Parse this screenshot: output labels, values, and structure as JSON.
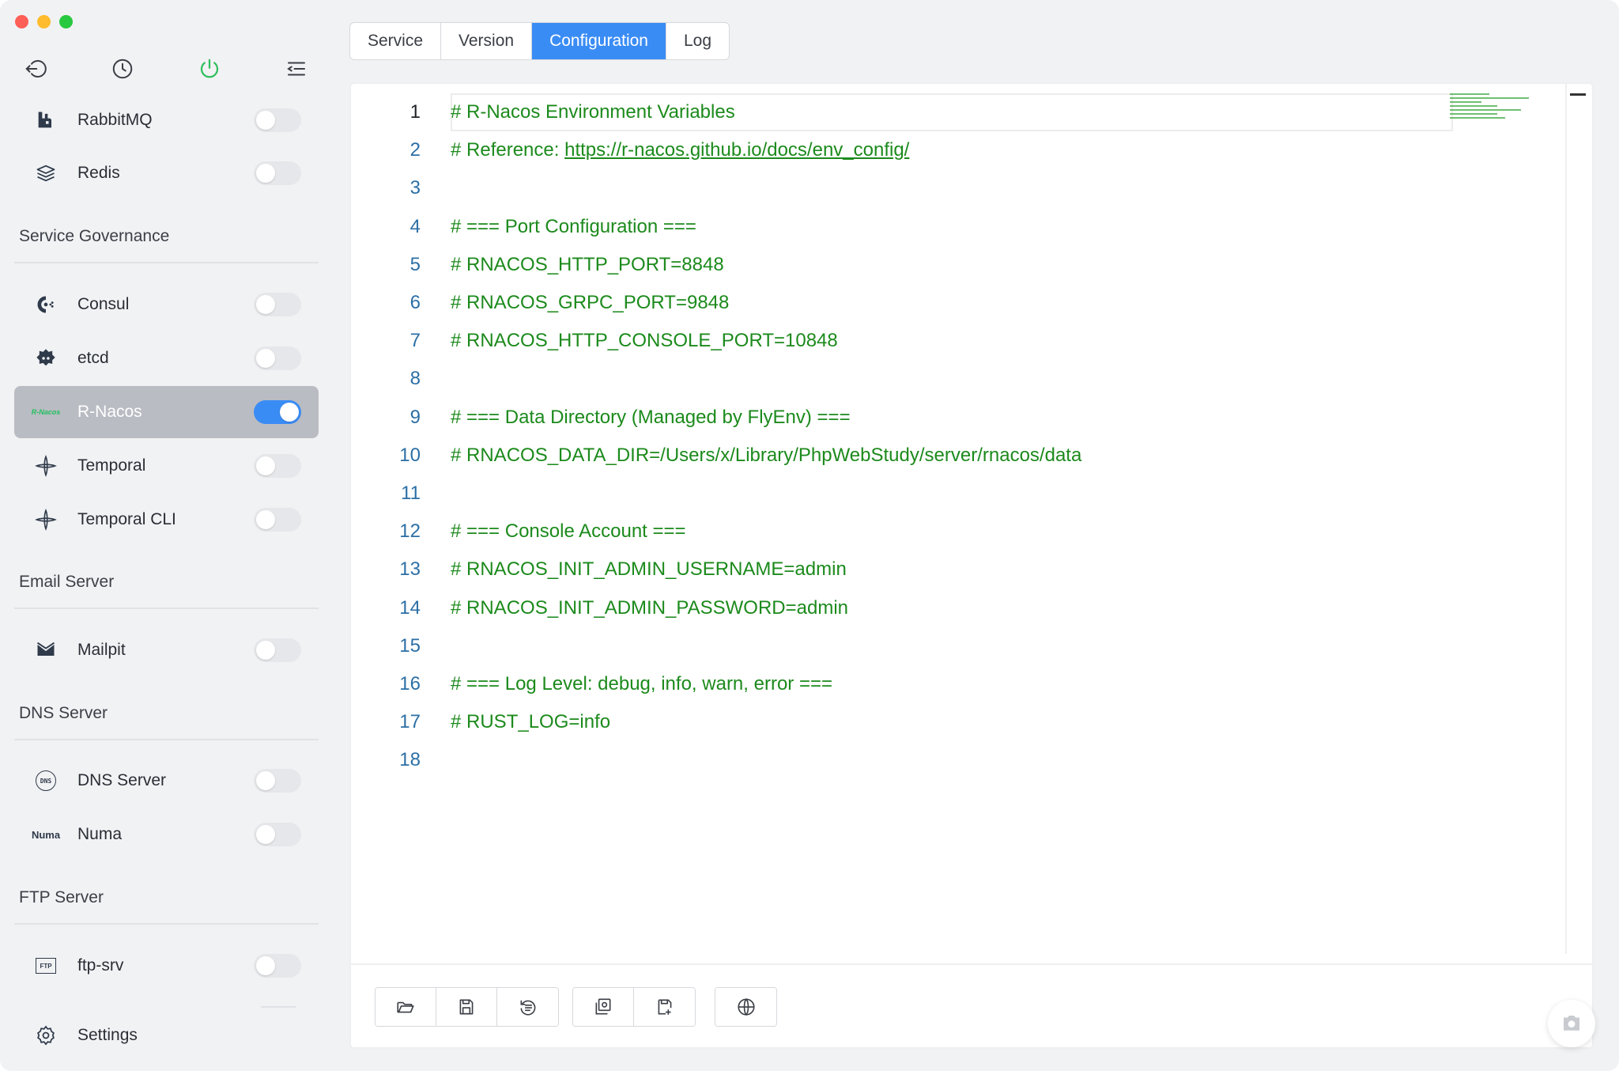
{
  "tabs": [
    {
      "label": "Service"
    },
    {
      "label": "Version"
    },
    {
      "label": "Configuration"
    },
    {
      "label": "Log"
    }
  ],
  "active_tab": "Configuration",
  "sidebar": {
    "top_icons": [
      "back-icon",
      "clock-icon",
      "power-icon",
      "menu-collapse-icon"
    ],
    "items_top": [
      {
        "label": "RabbitMQ",
        "icon": "rabbitmq-icon",
        "enabled": false
      },
      {
        "label": "Redis",
        "icon": "redis-icon",
        "enabled": false
      }
    ],
    "groups": [
      {
        "title": "Service Governance",
        "items": [
          {
            "label": "Consul",
            "icon": "consul-icon",
            "enabled": false
          },
          {
            "label": "etcd",
            "icon": "etcd-icon",
            "enabled": false
          },
          {
            "label": "R-Nacos",
            "icon": "rnacos-icon",
            "icon_text": "R-Nacos",
            "enabled": true,
            "active": true
          },
          {
            "label": "Temporal",
            "icon": "temporal-icon",
            "enabled": false
          },
          {
            "label": "Temporal CLI",
            "icon": "temporal-cli-icon",
            "enabled": false
          }
        ]
      },
      {
        "title": "Email Server",
        "items": [
          {
            "label": "Mailpit",
            "icon": "mailpit-icon",
            "enabled": false
          }
        ]
      },
      {
        "title": "DNS Server",
        "items": [
          {
            "label": "DNS Server",
            "icon": "dns-icon",
            "icon_text": "DNS",
            "enabled": false
          },
          {
            "label": "Numa",
            "icon": "numa-icon",
            "icon_text": "Numa",
            "enabled": false
          }
        ]
      },
      {
        "title": "FTP Server",
        "items": [
          {
            "label": "ftp-srv",
            "icon": "ftp-icon",
            "icon_text": "FTP",
            "enabled": false
          }
        ]
      }
    ],
    "settings_label": "Settings"
  },
  "editor": {
    "lines": [
      {
        "n": "1",
        "text": "# R-Nacos Environment Variables"
      },
      {
        "n": "2",
        "text": "# Reference: ",
        "link": "https://r-nacos.github.io/docs/env_config/"
      },
      {
        "n": "3",
        "text": ""
      },
      {
        "n": "4",
        "text": "# === Port Configuration ==="
      },
      {
        "n": "5",
        "text": "# RNACOS_HTTP_PORT=8848"
      },
      {
        "n": "6",
        "text": "# RNACOS_GRPC_PORT=9848"
      },
      {
        "n": "7",
        "text": "# RNACOS_HTTP_CONSOLE_PORT=10848"
      },
      {
        "n": "8",
        "text": ""
      },
      {
        "n": "9",
        "text": "# === Data Directory (Managed by FlyEnv) ==="
      },
      {
        "n": "10",
        "text": "# RNACOS_DATA_DIR=/Users/x/Library/PhpWebStudy/server/rnacos/data"
      },
      {
        "n": "11",
        "text": ""
      },
      {
        "n": "12",
        "text": "# === Console Account ==="
      },
      {
        "n": "13",
        "text": "# RNACOS_INIT_ADMIN_USERNAME=admin"
      },
      {
        "n": "14",
        "text": "# RNACOS_INIT_ADMIN_PASSWORD=admin"
      },
      {
        "n": "15",
        "text": ""
      },
      {
        "n": "16",
        "text": "# === Log Level: debug, info, warn, error ==="
      },
      {
        "n": "17",
        "text": "# RUST_LOG=info"
      },
      {
        "n": "18",
        "text": ""
      }
    ]
  },
  "toolbar_groups": [
    [
      "open-folder-icon",
      "save-icon",
      "reset-icon"
    ],
    [
      "load-custom-icon",
      "save-custom-icon"
    ],
    [
      "globe-icon"
    ]
  ],
  "colors": {
    "accent": "#3a8cf5",
    "code_comment": "#1c8a1c",
    "line_number": "#2c6fa5"
  }
}
